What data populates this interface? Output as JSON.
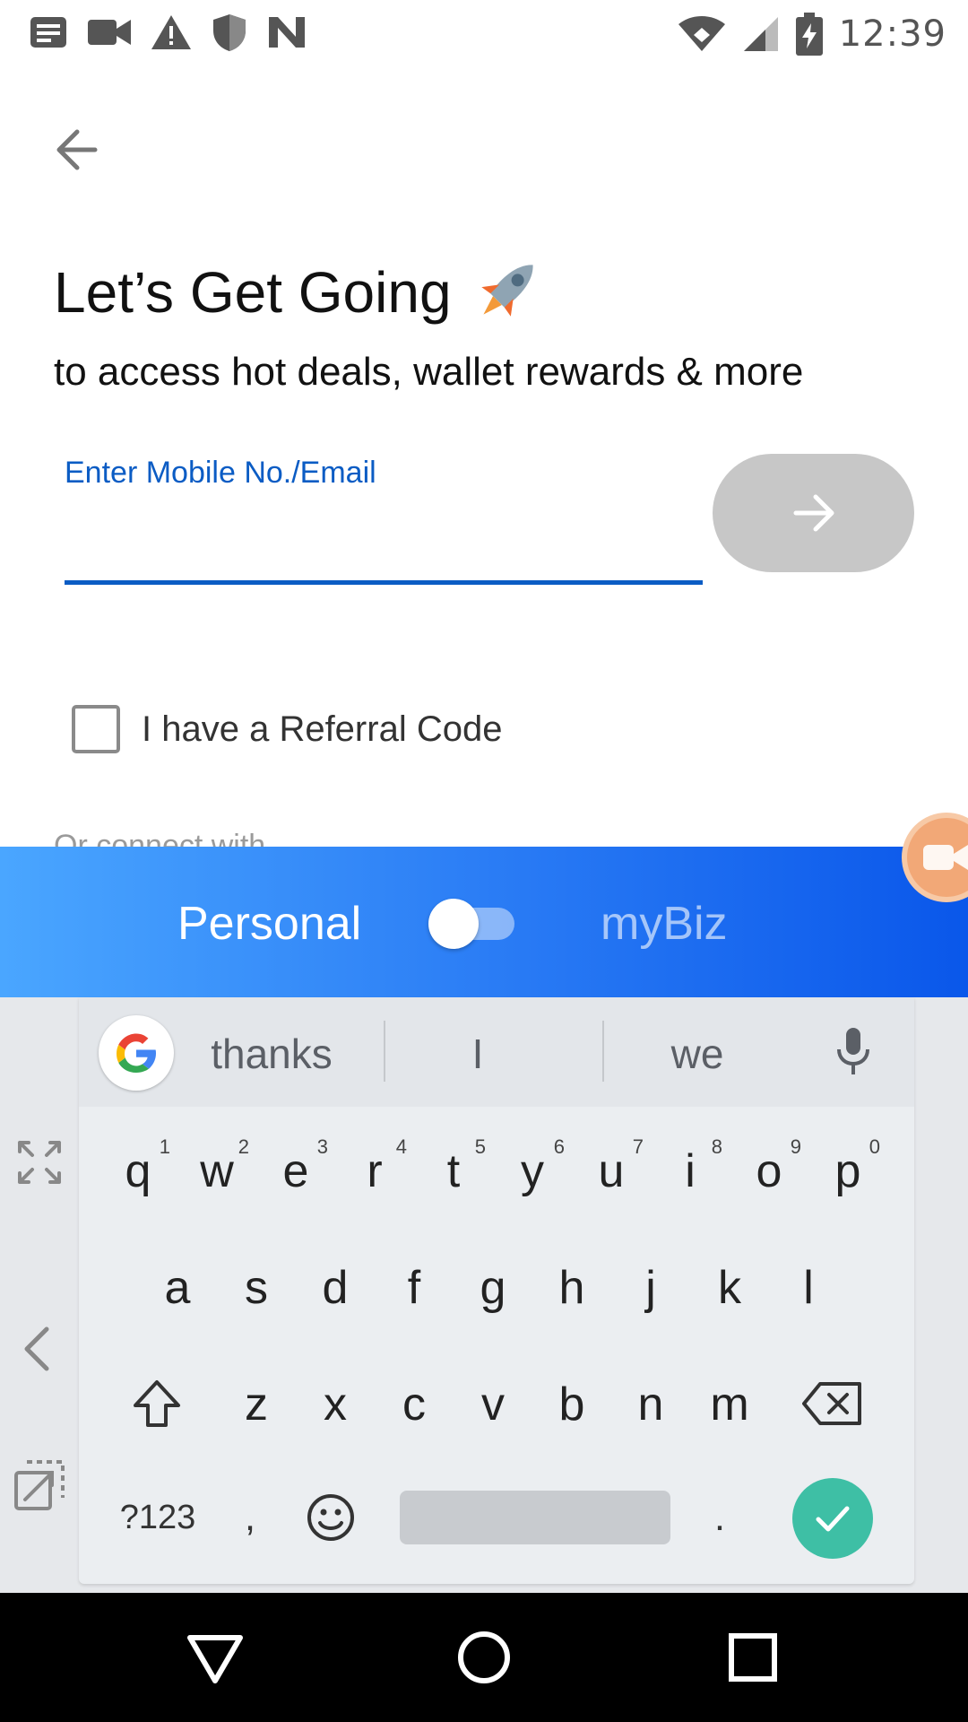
{
  "status_bar": {
    "time": "12:39",
    "left_icons": [
      "news-icon",
      "video-camera-icon",
      "warning-icon",
      "shield-icon",
      "n-icon"
    ],
    "right_icons": [
      "wifi-icon",
      "signal-icon",
      "battery-charging-icon"
    ]
  },
  "page": {
    "title": "Let’s Get Going",
    "title_emoji": "rocket-icon",
    "subtitle": "to access hot deals, wallet rewards & more",
    "input_label": "Enter Mobile No./Email",
    "input_value": "",
    "referral_label": "I have a Referral Code",
    "referral_checked": false,
    "connect_text": "Or connect with"
  },
  "mode_bar": {
    "personal_label": "Personal",
    "mybiz_label": "myBiz",
    "toggle_on": false
  },
  "keyboard": {
    "suggestions": [
      "thanks",
      "I",
      "we"
    ],
    "row1": [
      {
        "letter": "q",
        "hint": "1"
      },
      {
        "letter": "w",
        "hint": "2"
      },
      {
        "letter": "e",
        "hint": "3"
      },
      {
        "letter": "r",
        "hint": "4"
      },
      {
        "letter": "t",
        "hint": "5"
      },
      {
        "letter": "y",
        "hint": "6"
      },
      {
        "letter": "u",
        "hint": "7"
      },
      {
        "letter": "i",
        "hint": "8"
      },
      {
        "letter": "o",
        "hint": "9"
      },
      {
        "letter": "p",
        "hint": "0"
      }
    ],
    "row2": [
      "a",
      "s",
      "d",
      "f",
      "g",
      "h",
      "j",
      "k",
      "l"
    ],
    "row3": [
      "z",
      "x",
      "c",
      "v",
      "b",
      "n",
      "m"
    ],
    "sym_label": "?123",
    "comma": ",",
    "period": "."
  },
  "colors": {
    "accent_blue": "#0b5cc4",
    "mode_bar_start": "#4aa6ff",
    "mode_bar_end": "#0a57ea",
    "enter_green": "#3ebfa5",
    "next_button_disabled": "#c7c7c7"
  }
}
